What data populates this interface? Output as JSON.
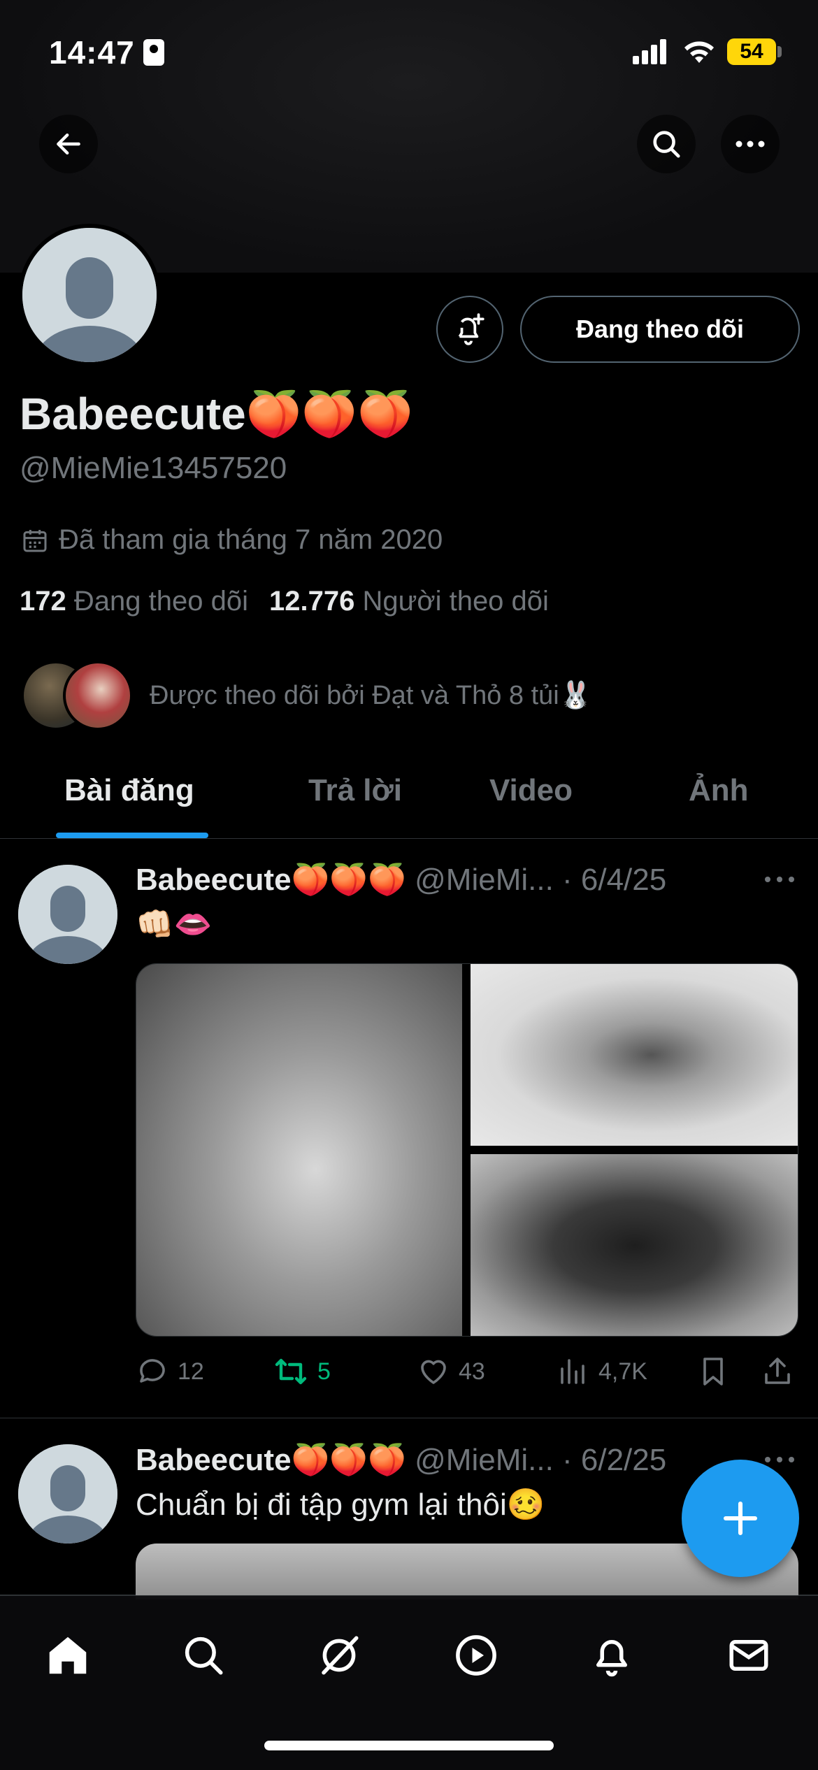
{
  "status": {
    "time": "14:47",
    "battery": "54"
  },
  "profile": {
    "display_name": "Babeecute🍑🍑🍑",
    "handle": "@MieMie13457520",
    "joined": "Đã tham gia tháng 7 năm 2020",
    "following_count": "172",
    "following_label": "Đang theo dõi",
    "followers_count": "12.776",
    "followers_label": "Người theo dõi",
    "followed_by": "Được theo dõi bởi Đạt và Thỏ 8 tủi🐰",
    "follow_button": "Đang theo dõi"
  },
  "tabs": [
    {
      "label": "Bài đăng",
      "active": true
    },
    {
      "label": "Trả lời",
      "active": false
    },
    {
      "label": "Video",
      "active": false
    },
    {
      "label": "Ảnh",
      "active": false
    }
  ],
  "tweets": [
    {
      "name": "Babeecute🍑🍑🍑",
      "meta": "@MieMi... · 6/4/25",
      "text": "👊🏻👄",
      "replies": "12",
      "retweets": "5",
      "likes": "43",
      "views": "4,7K"
    },
    {
      "name": "Babeecute🍑🍑🍑",
      "meta": "@MieMi... · 6/2/25",
      "text": "Chuẩn bị đi tập gym lại thôi🥴"
    }
  ],
  "icons": {
    "back": "arrow-left-icon",
    "search": "search-icon",
    "more": "more-icon",
    "bell": "bell-plus-icon",
    "calendar": "calendar-icon",
    "compose": "plus-icon",
    "nav": [
      "home-icon",
      "search-icon",
      "grok-icon",
      "play-icon",
      "bell-icon",
      "mail-icon"
    ]
  },
  "colors": {
    "accent": "#1d9bf0",
    "retweet": "#00ba7c",
    "muted": "#71767b"
  }
}
